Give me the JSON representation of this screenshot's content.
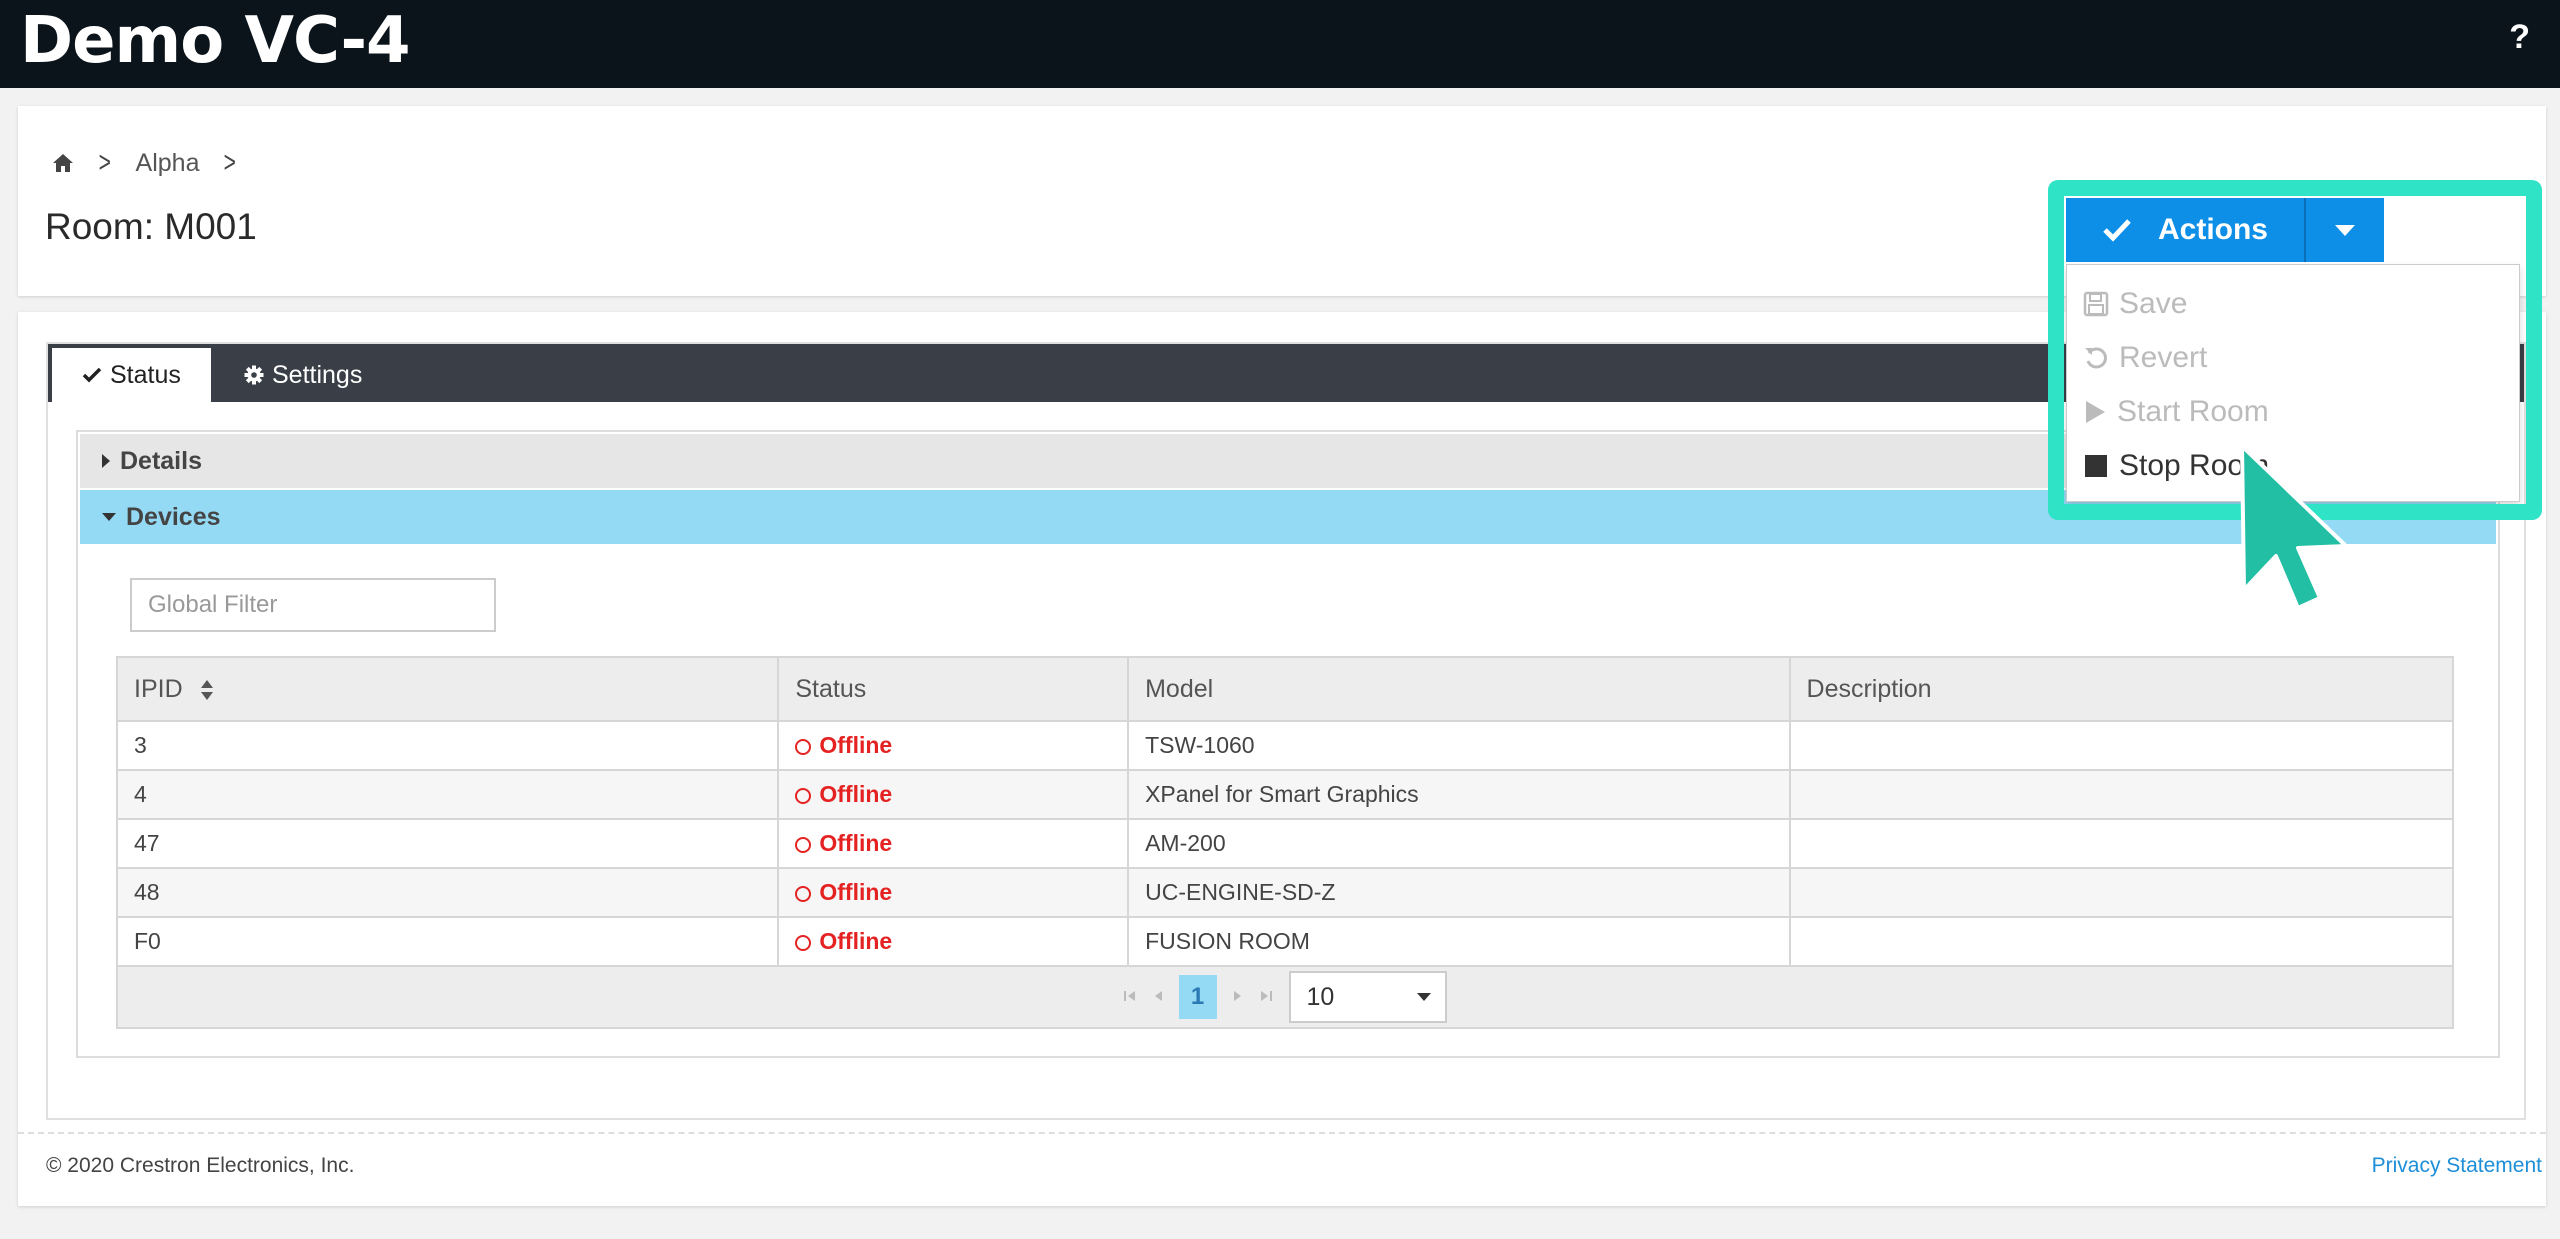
{
  "app": {
    "title": "Demo VC-4",
    "help": "?"
  },
  "breadcrumb": {
    "items": [
      "Alpha"
    ]
  },
  "page": {
    "title": "Room: M001"
  },
  "actions": {
    "label": "Actions",
    "menu": [
      {
        "label": "Save",
        "icon": "save-icon",
        "enabled": false
      },
      {
        "label": "Revert",
        "icon": "revert-icon",
        "enabled": false
      },
      {
        "label": "Start Room",
        "icon": "play-icon",
        "enabled": false
      },
      {
        "label": "Stop Room",
        "icon": "stop-icon",
        "enabled": true
      }
    ]
  },
  "tabs": [
    {
      "label": "Status",
      "icon": "check-icon",
      "active": true
    },
    {
      "label": "Settings",
      "icon": "gear-icon",
      "active": false
    }
  ],
  "accordion": {
    "details": "Details",
    "devices": "Devices"
  },
  "filter": {
    "placeholder": "Global Filter"
  },
  "table": {
    "columns": [
      "IPID",
      "Status",
      "Model",
      "Description"
    ],
    "rows": [
      {
        "ipid": "3",
        "status": "Offline",
        "model": "TSW-1060",
        "description": ""
      },
      {
        "ipid": "4",
        "status": "Offline",
        "model": "XPanel for Smart Graphics",
        "description": ""
      },
      {
        "ipid": "47",
        "status": "Offline",
        "model": "AM-200",
        "description": ""
      },
      {
        "ipid": "48",
        "status": "Offline",
        "model": "UC-ENGINE-SD-Z",
        "description": ""
      },
      {
        "ipid": "F0",
        "status": "Offline",
        "model": "FUSION ROOM",
        "description": ""
      }
    ]
  },
  "pagination": {
    "current_page": "1",
    "page_size": "10"
  },
  "footer": {
    "copyright": "© 2020 Crestron Electronics, Inc.",
    "privacy": "Privacy Statement"
  },
  "colors": {
    "topbar": "#0c141b",
    "accent": "#0d8fe8",
    "highlight": "#2ee3c6",
    "devices_header": "#94daf4",
    "offline": "#e52222"
  }
}
